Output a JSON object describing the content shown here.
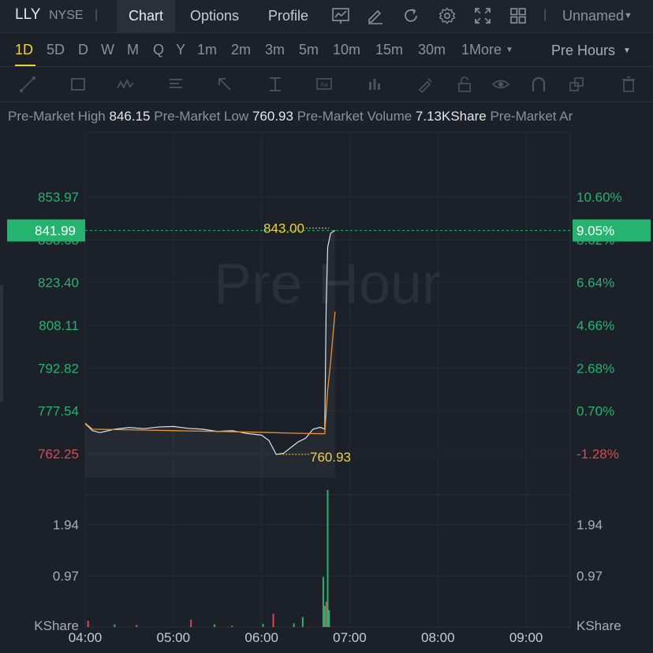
{
  "header": {
    "ticker": "LLY",
    "exchange": "NYSE",
    "tabs": [
      {
        "label": "Chart",
        "active": true
      },
      {
        "label": "Options",
        "active": false
      },
      {
        "label": "Profile",
        "active": false
      }
    ],
    "toolbar_icons": [
      "chart-line-icon",
      "edit-pen-icon",
      "refresh-icon",
      "settings-gear-icon",
      "fullscreen-icon",
      "grid-layout-icon"
    ],
    "layout_name": "Unnamed"
  },
  "timeframes": {
    "items": [
      "1D",
      "5D",
      "D",
      "W",
      "M",
      "Q",
      "Y",
      "1m",
      "2m",
      "3m",
      "5m",
      "10m",
      "15m",
      "30m"
    ],
    "active": "1D",
    "more_label": "1More",
    "session_label": "Pre Hours"
  },
  "drawing_tools": [
    "trendline-icon",
    "rectangle-icon",
    "pattern-icon",
    "fibonacci-icon",
    "arrow-icon",
    "measure-icon",
    "text-icon",
    "bar-chart-icon",
    "brush-icon",
    "lock-icon",
    "eye-icon",
    "magnet-icon",
    "layers-icon",
    "trash-icon"
  ],
  "stats": {
    "high_label": "Pre-Market High",
    "high_value": "846.15",
    "low_label": "Pre-Market Low",
    "low_value": "760.93",
    "volume_label": "Pre-Market Volume",
    "volume_value": "7.13KShare",
    "amount_label": "Pre-Market Ar"
  },
  "colors": {
    "up": "#26b36f",
    "down": "#e0474c",
    "accent": "#f2d23a",
    "avg_line": "#e9922e",
    "price_line": "#dfe2e6",
    "current_badge": "#26b36f"
  },
  "chart_data": [
    {
      "type": "line",
      "watermark": "Pre Hour",
      "x_ticks": [
        "04:00",
        "05:00",
        "06:00",
        "07:00",
        "08:00",
        "09:00"
      ],
      "y_ticks_left": [
        "853.97",
        "838.68",
        "823.40",
        "808.11",
        "792.82",
        "777.54",
        "762.25"
      ],
      "y_ticks_right": [
        "10.60%",
        "8.62%",
        "6.64%",
        "4.66%",
        "2.68%",
        "0.70%",
        "-1.28%"
      ],
      "ylim": [
        762.25,
        853.97
      ],
      "current_price": "841.99",
      "current_change": "9.05%",
      "high_marker": "843.00",
      "low_marker": "760.93",
      "series": [
        {
          "name": "price",
          "x": [
            "04:00",
            "04:05",
            "04:10",
            "04:20",
            "04:30",
            "04:40",
            "04:50",
            "05:00",
            "05:10",
            "05:20",
            "05:30",
            "05:40",
            "05:50",
            "06:00",
            "06:05",
            "06:10",
            "06:15",
            "06:20",
            "06:25",
            "06:30",
            "06:35",
            "06:40",
            "06:43",
            "06:44",
            "06:45",
            "06:47",
            "06:50"
          ],
          "y": [
            773.0,
            770.5,
            769.8,
            771.0,
            771.6,
            771.2,
            771.8,
            772.0,
            771.3,
            771.0,
            770.2,
            770.5,
            769.5,
            768.9,
            767.0,
            762.0,
            762.4,
            764.5,
            766.5,
            767.8,
            771.0,
            771.7,
            771.0,
            816.0,
            836.0,
            841.0,
            842.0
          ]
        },
        {
          "name": "average",
          "x": [
            "04:00",
            "04:05",
            "04:30",
            "05:00",
            "05:30",
            "06:00",
            "06:20",
            "06:40",
            "06:43",
            "06:45",
            "06:47",
            "06:50"
          ],
          "y": [
            773.2,
            771.0,
            770.8,
            770.5,
            770.2,
            769.9,
            769.6,
            769.4,
            769.4,
            785.0,
            795.0,
            813.0
          ]
        }
      ]
    },
    {
      "type": "bar",
      "y_unit": "KShare",
      "y_ticks": [
        "1.94",
        "0.97"
      ],
      "ylim": [
        0,
        2.9
      ],
      "bars": [
        {
          "x": "04:02",
          "v": 0.12,
          "dir": "down"
        },
        {
          "x": "04:20",
          "v": 0.05,
          "dir": "up"
        },
        {
          "x": "04:35",
          "v": 0.04,
          "dir": "down"
        },
        {
          "x": "05:12",
          "v": 0.14,
          "dir": "down"
        },
        {
          "x": "05:28",
          "v": 0.05,
          "dir": "up"
        },
        {
          "x": "05:40",
          "v": 0.03,
          "dir": "down"
        },
        {
          "x": "06:01",
          "v": 0.06,
          "dir": "up"
        },
        {
          "x": "06:08",
          "v": 0.25,
          "dir": "down"
        },
        {
          "x": "06:22",
          "v": 0.07,
          "dir": "up"
        },
        {
          "x": "06:28",
          "v": 0.19,
          "dir": "up"
        },
        {
          "x": "06:42",
          "v": 0.95,
          "dir": "up"
        },
        {
          "x": "06:43",
          "v": 0.4,
          "dir": "up"
        },
        {
          "x": "06:44",
          "v": 0.48,
          "dir": "down"
        },
        {
          "x": "06:45",
          "v": 2.6,
          "dir": "up"
        },
        {
          "x": "06:46",
          "v": 0.32,
          "dir": "up"
        }
      ]
    }
  ]
}
